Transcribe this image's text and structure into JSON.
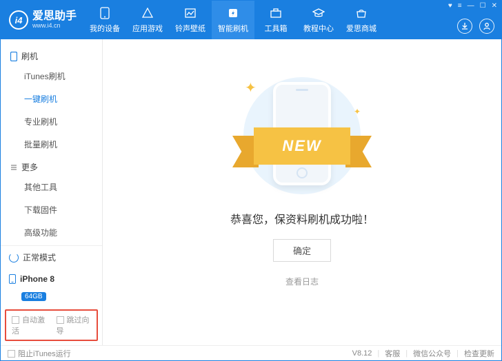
{
  "brand": {
    "name": "爱思助手",
    "url": "www.i4.cn",
    "logoText": "i4"
  },
  "nav": {
    "items": [
      {
        "label": "我的设备"
      },
      {
        "label": "应用游戏"
      },
      {
        "label": "铃声壁纸"
      },
      {
        "label": "智能刷机"
      },
      {
        "label": "工具箱"
      },
      {
        "label": "教程中心"
      },
      {
        "label": "爱思商城"
      }
    ],
    "activeIndex": 3
  },
  "sidebar": {
    "sections": [
      {
        "title": "刷机",
        "items": [
          "iTunes刷机",
          "一键刷机",
          "专业刷机",
          "批量刷机"
        ],
        "activeIndex": 1
      },
      {
        "title": "更多",
        "items": [
          "其他工具",
          "下载固件",
          "高级功能"
        ]
      }
    ],
    "mode": "正常模式",
    "device": {
      "name": "iPhone 8",
      "storage": "64GB"
    },
    "opts": {
      "autoActivateLabel": "自动激活",
      "skipGuideLabel": "跳过向导"
    }
  },
  "main": {
    "ribbon": "NEW",
    "successText": "恭喜您，保资料刷机成功啦！",
    "confirmLabel": "确定",
    "logLink": "查看日志"
  },
  "footer": {
    "blockItunes": "阻止iTunes运行",
    "version": "V8.12",
    "links": [
      "客服",
      "微信公众号",
      "检查更新"
    ]
  }
}
